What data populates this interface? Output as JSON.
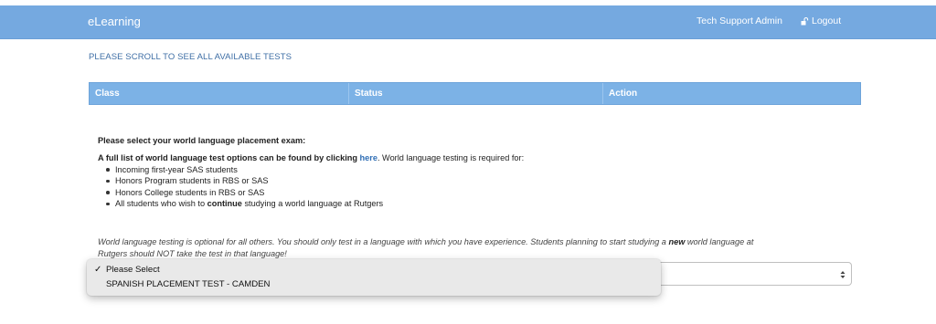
{
  "app": {
    "brand": "eLearning",
    "user_link": "Tech Support Admin",
    "logout_label": "Logout"
  },
  "page": {
    "scroll_note": "PLEASE SCROLL TO SEE ALL AVAILABLE TESTS"
  },
  "table": {
    "columns": [
      "Class",
      "Status",
      "Action"
    ]
  },
  "exam": {
    "prompt": "Please select your world language placement exam:",
    "info_prefix": "A full list of world language test options can be found by clicking ",
    "info_link": "here",
    "info_suffix": ". World language testing is required for:",
    "requirements": [
      "Incoming first-year SAS students",
      "Honors Program students in RBS or SAS",
      "Honors College students in RBS or SAS"
    ],
    "req_last_prefix": "All students who wish to ",
    "req_last_bold": "continue",
    "req_last_suffix": " studying a world language at Rutgers",
    "optional_1": "World language testing is optional for all others. You should only test in a language with which you have experience. Students planning to start studying a ",
    "optional_bold": "new",
    "optional_2": " world language at",
    "optional_3": "Rutgers should NOT take the test in that language!"
  },
  "dropdown": {
    "selected_mark": "✓",
    "options": [
      "Please Select",
      "SPANISH PLACEMENT TEST  - CAMDEN"
    ]
  },
  "colors": {
    "topbar": "#75a9e0",
    "table_header": "#7cb2e6",
    "link": "#2f6eb5"
  }
}
